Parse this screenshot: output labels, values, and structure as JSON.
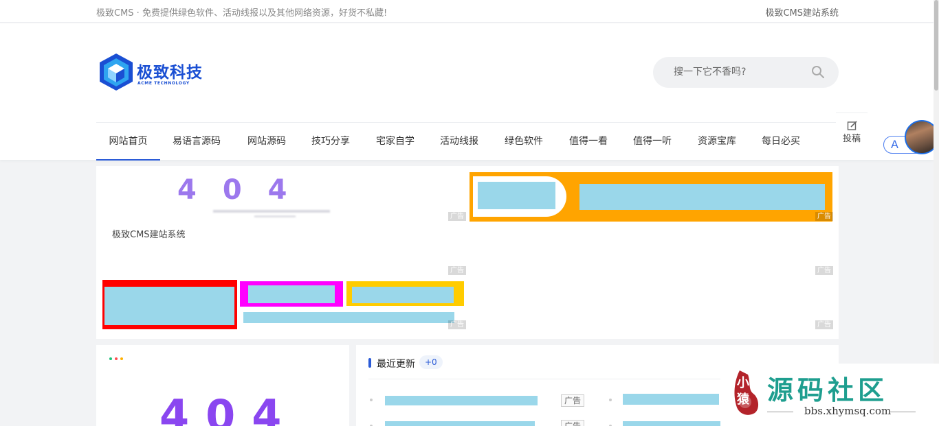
{
  "topbar": {
    "tagline": "极致CMS · 免费提供绿色软件、活动线报以及其他网络资源，好货不私藏!",
    "site_link": "极致CMS建站系统"
  },
  "logo": {
    "name_cn": "极致科技",
    "name_en": "ACME TECHNOLOGY"
  },
  "search": {
    "placeholder": "搜一下它不香吗?"
  },
  "nav": {
    "items": [
      "网站首页",
      "易语言源码",
      "网站源码",
      "技巧分享",
      "宅家自学",
      "活动线报",
      "绿色软件",
      "值得一看",
      "值得一听",
      "资源宝库",
      "每日必买"
    ]
  },
  "submit": {
    "label": "投稿"
  },
  "lang": {
    "label": "A"
  },
  "ads": {
    "tag": "广告",
    "error_code": "404",
    "broken_img_alt": "极致CMS建站系统"
  },
  "recent": {
    "title": "最近更新",
    "count": "+0",
    "ad_label": "广告"
  },
  "watermark": {
    "brand": "源码社区",
    "url": "bbs.xhymsq.com",
    "seal": "小猿"
  },
  "colors": {
    "accent": "#2b5bd7",
    "ad_orange": "#ffa400",
    "ad_red": "#ff0000",
    "ad_magenta": "#ff00ff",
    "ad_yellow": "#ffcc00",
    "redacted": "#9ad7ea"
  }
}
